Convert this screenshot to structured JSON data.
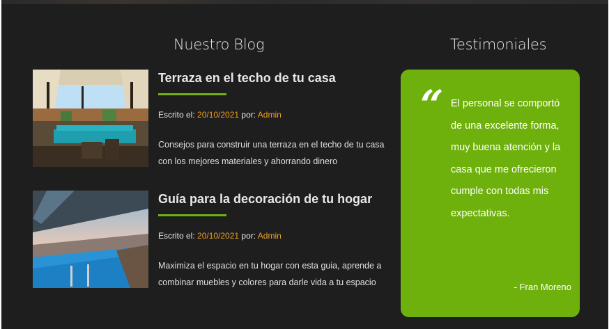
{
  "blog": {
    "title": "Nuestro Blog",
    "posts": [
      {
        "title": "Terraza en el techo de tu casa",
        "meta_prefix": "Escrito el: ",
        "date": "20/10/2021",
        "by_label": " por: ",
        "author": "Admin",
        "excerpt": "Consejos para construir una terraza en el techo de tu casa con los mejores materiales y ahorrando dinero",
        "image": "rooftop-terrace-photo"
      },
      {
        "title": "Guía para la decoración de tu hogar",
        "meta_prefix": "Escrito el: ",
        "date": "20/10/2021",
        "by_label": " por: ",
        "author": "Admin",
        "excerpt": "Maximiza el espacio en tu hogar con esta guia, aprende a combinar muebles y colores para darle vida a tu espacio",
        "image": "infinity-pool-photo"
      }
    ]
  },
  "testimonials": {
    "title": "Testimoniales",
    "quote_icon": "quote-icon",
    "text": "El personal se comportó de una excelente forma, muy buena atención y la casa que me ofrecieron cumple con todas mis expectativas.",
    "author": "- Fran Moreno"
  },
  "colors": {
    "background": "#1e1e1e",
    "accent_green": "#6fb10c",
    "accent_orange": "#f0a020",
    "text_light": "#e8e8e8"
  }
}
